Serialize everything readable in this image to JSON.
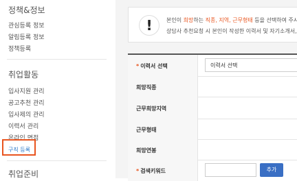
{
  "sidebar": {
    "sections": [
      {
        "title": "정책&정보",
        "items": [
          "관심등록 정보",
          "알림등록 정보",
          "정책등록"
        ]
      },
      {
        "title": "취업활동",
        "items": [
          "입사지원 관리",
          "공고추천 관리",
          "입사제의 관리",
          "이력서 관리",
          "온라인 면접"
        ]
      },
      {
        "title": "취업준비",
        "items": []
      }
    ],
    "active_item": "구직 등록"
  },
  "notice": {
    "line1_prefix": "본인이 ",
    "line1_hl1": "희망",
    "line1_mid1": "하는 ",
    "line1_hl2": "직종, 지역, 근무형태",
    "line1_suffix": " 등을 선택하여 주시기",
    "line2": "상담사 추천요청 시 본인이 작성한 이력서 및 자기소개서, 취"
  },
  "form": {
    "resume_label": "이력서 선택",
    "resume_value": "이력서 선택",
    "job_label": "희망직종",
    "region_label": "근무희망지역",
    "worktype_label": "근무형태",
    "salary_label": "희망연봉",
    "keyword_label": "검색키워드",
    "keyword_value": "",
    "add_button": "추가",
    "required_mark": "*"
  },
  "colors": {
    "accent": "#e8541e",
    "link": "#2a78c8",
    "button": "#3a6fc4"
  }
}
